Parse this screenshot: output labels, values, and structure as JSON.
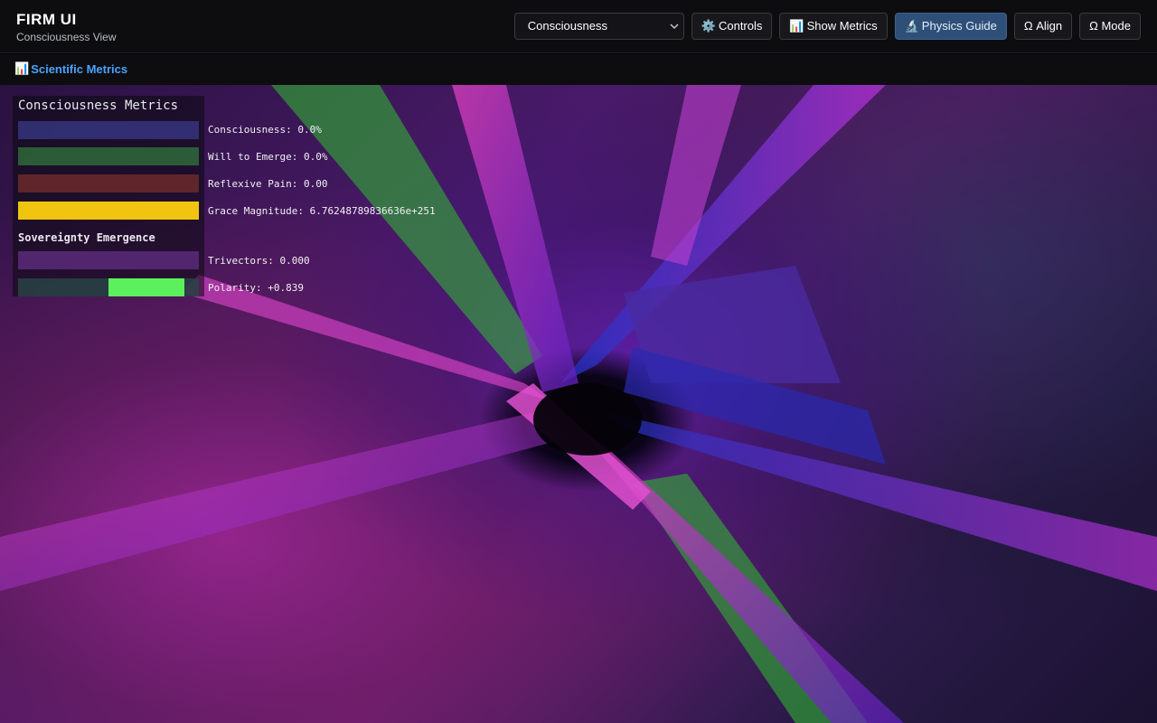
{
  "app": {
    "title": "FIRM UI",
    "subtitle": "Consciousness View"
  },
  "header": {
    "mode_select": {
      "value": "Consciousness"
    },
    "buttons": {
      "controls": {
        "icon": "⚙️",
        "label": "Controls"
      },
      "show_metrics": {
        "icon": "📊",
        "label": "Show Metrics"
      },
      "physics_guide": {
        "icon": "🔬",
        "label": "Physics Guide",
        "active": true
      },
      "align": {
        "label": "Ω Align"
      },
      "mode": {
        "label": "Ω Mode"
      }
    }
  },
  "subbar": {
    "icon": "📊",
    "label": "Scientific Metrics"
  },
  "metrics": {
    "title": "Consciousness Metrics",
    "consciousness": {
      "label": "Consciousness: 0.0%",
      "value": 0.0,
      "color": "#3a3a8a"
    },
    "will_to_emerge": {
      "label": "Will to Emerge: 0.0%",
      "value": 0.0,
      "color": "#2f6a3a"
    },
    "reflexive_pain": {
      "label": "Reflexive Pain: 0.00",
      "value": 0.0,
      "color": "#6a2a2a"
    },
    "grace_magnitude": {
      "label": "Grace Magnitude: 6.76248789836636e+251",
      "value": 1.0,
      "color": "#f1c40f"
    }
  },
  "sovereignty": {
    "title": "Sovereignty Emergence",
    "trivectors": {
      "label": "Trivectors: 0.000",
      "value": 0.0,
      "color": "#5a2a7a"
    },
    "polarity": {
      "label": "Polarity: +0.839",
      "value": 0.839,
      "color": "#5cf05c"
    }
  }
}
